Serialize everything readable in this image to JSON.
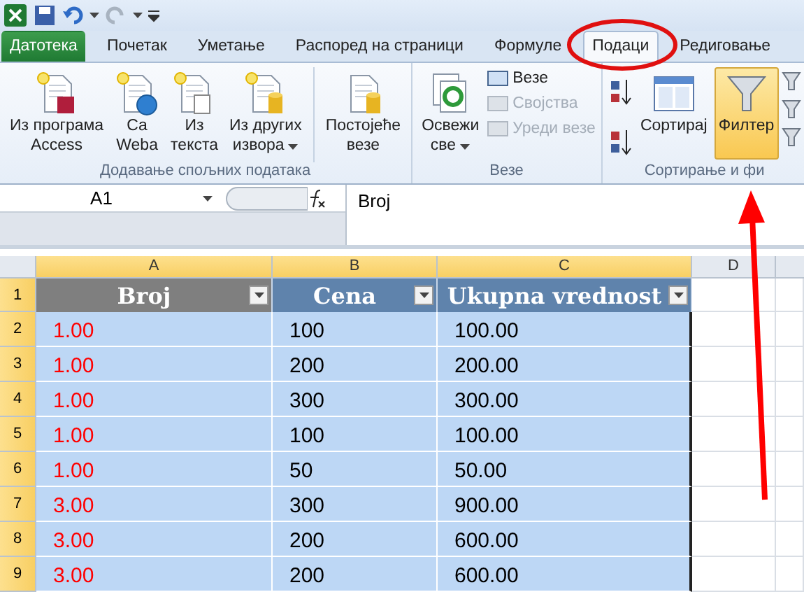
{
  "tabs": [
    {
      "label": "Датотека",
      "kind": "file",
      "selected": false
    },
    {
      "label": "Почетак",
      "kind": "tab",
      "selected": false
    },
    {
      "label": "Уметање",
      "kind": "tab",
      "selected": false
    },
    {
      "label": "Распоред на страници",
      "kind": "tab",
      "selected": false
    },
    {
      "label": "Формуле",
      "kind": "tab",
      "selected": false
    },
    {
      "label": "Подаци",
      "kind": "tab",
      "selected": true
    },
    {
      "label": "Редиговање",
      "kind": "tab",
      "selected": false
    }
  ],
  "ribbon_groups": [
    {
      "label": "Додавање спољних података",
      "items": [
        {
          "kind": "large",
          "lines": [
            "Из програма",
            "Access"
          ],
          "dropdown": false
        },
        {
          "kind": "large",
          "lines": [
            "Са",
            "Weba"
          ],
          "dropdown": false
        },
        {
          "kind": "large",
          "lines": [
            "Из",
            "текста"
          ],
          "dropdown": false
        },
        {
          "kind": "large",
          "lines": [
            "Из других",
            "извора"
          ],
          "dropdown": true
        },
        {
          "kind": "separator"
        },
        {
          "kind": "large",
          "lines": [
            "Постојеће",
            "везе"
          ],
          "dropdown": false
        }
      ]
    },
    {
      "label": "Везе",
      "items": [
        {
          "kind": "large",
          "lines": [
            "Освежи",
            "све"
          ],
          "dropdown": true
        },
        {
          "kind": "stack",
          "entries": [
            {
              "label": "Везе",
              "disabled": false
            },
            {
              "label": "Својства",
              "disabled": true
            },
            {
              "label": "Уреди везе",
              "disabled": true
            }
          ]
        }
      ]
    },
    {
      "label": "Сортирање и фи",
      "items": [
        {
          "kind": "sortpair"
        },
        {
          "kind": "large",
          "lines": [
            "Сортирај"
          ],
          "dropdown": false,
          "active": false
        },
        {
          "kind": "large",
          "lines": [
            "Филтер"
          ],
          "dropdown": false,
          "active": true
        },
        {
          "kind": "partial"
        }
      ]
    }
  ],
  "name_box": "A1",
  "formula": "Broj",
  "column_headers": [
    {
      "label": "A",
      "selected": true
    },
    {
      "label": "B",
      "selected": true
    },
    {
      "label": "C",
      "selected": true
    },
    {
      "label": "D",
      "selected": false
    }
  ],
  "table": {
    "columns": [
      {
        "header": "Broj",
        "active": true,
        "color": "#ff0000"
      },
      {
        "header": "Cena",
        "active": false,
        "color": "#000000"
      },
      {
        "header": "Ukupna vrednost",
        "active": false,
        "color": "#000000"
      }
    ],
    "rows": [
      {
        "number": "1",
        "selected": true,
        "cells": []
      },
      {
        "number": "2",
        "selected": true,
        "cells": [
          "1.00",
          "100",
          "100.00"
        ]
      },
      {
        "number": "3",
        "selected": true,
        "cells": [
          "1.00",
          "200",
          "200.00"
        ]
      },
      {
        "number": "4",
        "selected": true,
        "cells": [
          "1.00",
          "300",
          "300.00"
        ]
      },
      {
        "number": "5",
        "selected": true,
        "cells": [
          "1.00",
          "100",
          "100.00"
        ]
      },
      {
        "number": "6",
        "selected": true,
        "cells": [
          "1.00",
          "50",
          "50.00"
        ]
      },
      {
        "number": "7",
        "selected": true,
        "cells": [
          "3.00",
          "300",
          "900.00"
        ]
      },
      {
        "number": "8",
        "selected": true,
        "cells": [
          "3.00",
          "200",
          "600.00"
        ]
      },
      {
        "number": "9",
        "selected": true,
        "cells": [
          "3.00",
          "200",
          "600.00"
        ]
      }
    ]
  }
}
